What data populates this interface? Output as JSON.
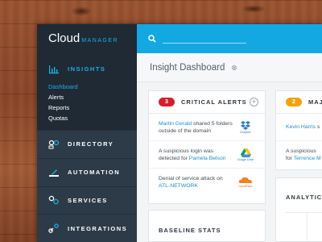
{
  "brand": {
    "name": "Cloud",
    "suffix": "MANAGER"
  },
  "sidebar": {
    "insights": {
      "label": "INSIGHTS",
      "subitems": [
        "Dashboard",
        "Alerts",
        "Reports",
        "Quotas"
      ]
    },
    "items": [
      {
        "label": "DIRECTORY",
        "icon": "directory-icon"
      },
      {
        "label": "AUTOMATION",
        "icon": "automation-icon"
      },
      {
        "label": "SERVICES",
        "icon": "services-icon"
      },
      {
        "label": "INTEGRATIONS",
        "icon": "integrations-icon"
      }
    ]
  },
  "search": {
    "placeholder": ""
  },
  "page": {
    "title": "Insight Dashboard"
  },
  "critical_alerts": {
    "count": "3",
    "title": "CRITICAL ALERTS",
    "rows": [
      {
        "link": "Martin Gerald",
        "text": " shared 5 folders outside of the domain",
        "logo": "Dropbox"
      },
      {
        "pre": "A suspicious login was detected for ",
        "link": "Pamela Belson",
        "logo": "Google Drive"
      },
      {
        "pre": "Denial of service attack on ",
        "link": "ATL-NETWORK",
        "logo": "CloudFlare"
      }
    ]
  },
  "major_alerts": {
    "count": "2",
    "title": "MAJ",
    "rows": [
      {
        "link": "Kevin Harris",
        "text": " s"
      },
      {
        "pre": "A suspicious",
        "link2": "for ",
        "link": "Terrence M"
      }
    ]
  },
  "baseline": {
    "title": "BASELINE STATS"
  },
  "analytics": {
    "title": "ANALYTICS"
  },
  "colors": {
    "accent": "#14a8e3",
    "critical": "#d0212b",
    "major": "#f2a30f",
    "sidebar": "#2a3744"
  }
}
